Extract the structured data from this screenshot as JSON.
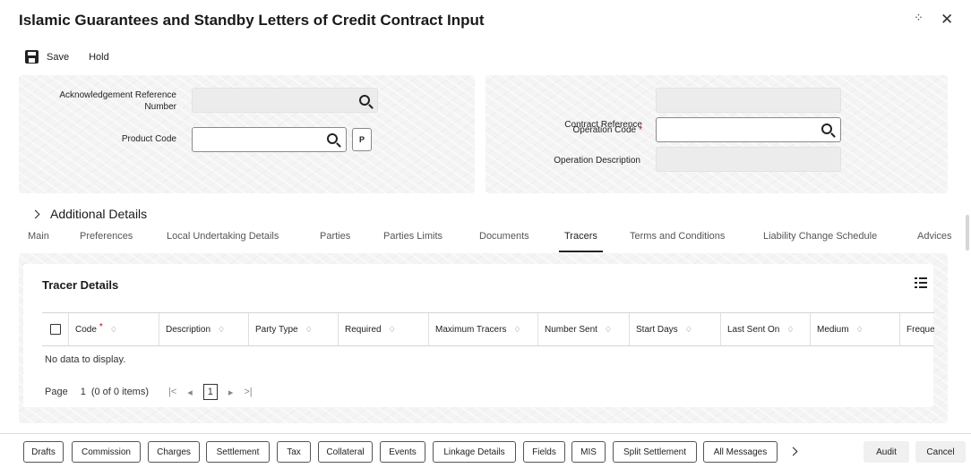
{
  "window": {
    "title": "Islamic Guarantees and Standby Letters of Credit Contract Input",
    "expand_glyph": "⁘",
    "close_glyph": "✕"
  },
  "toolbar": {
    "save_label": "Save",
    "hold_label": "Hold"
  },
  "header_left": {
    "ack_ref_label": "Acknowledgement Reference Number",
    "ack_ref_value": "",
    "product_code_label": "Product Code",
    "product_code_value": "",
    "p_button_label": "P"
  },
  "header_right": {
    "contract_ref_label": "Contract Reference",
    "contract_ref_value": "",
    "operation_code_label": "Operation Code",
    "operation_code_required": "*",
    "operation_code_value": "",
    "operation_desc_label": "Operation Description",
    "operation_desc_value": ""
  },
  "additional_details_label": "Additional Details",
  "tabs": [
    {
      "label": "Main",
      "active": false
    },
    {
      "label": "Preferences",
      "active": false
    },
    {
      "label": "Local Undertaking Details",
      "active": false
    },
    {
      "label": "Parties",
      "active": false
    },
    {
      "label": "Parties Limits",
      "active": false
    },
    {
      "label": "Documents",
      "active": false
    },
    {
      "label": "Tracers",
      "active": true
    },
    {
      "label": "Terms and Conditions",
      "active": false
    },
    {
      "label": "Liability Change Schedule",
      "active": false
    },
    {
      "label": "Advices",
      "active": false
    }
  ],
  "tracer": {
    "title": "Tracer Details",
    "columns": [
      {
        "label": "Code",
        "required": "*",
        "sort": "♢"
      },
      {
        "label": "Description",
        "sort": "♢"
      },
      {
        "label": "Party Type",
        "sort": "♢"
      },
      {
        "label": "Required",
        "sort": "♢"
      },
      {
        "label": "Maximum Tracers",
        "sort": "♢"
      },
      {
        "label": "Number Sent",
        "sort": "♢"
      },
      {
        "label": "Start Days",
        "sort": "♢"
      },
      {
        "label": "Last Sent On",
        "sort": "♢"
      },
      {
        "label": "Medium",
        "sort": "♢"
      },
      {
        "label": "Freque"
      }
    ],
    "empty_text": "No data to display.",
    "pager": {
      "page_label": "Page",
      "page_number": "1",
      "items_text": "(0 of 0 items)",
      "first": "|<",
      "prev": "◂",
      "current": "1",
      "next": "▸",
      "last": ">|"
    }
  },
  "footer": {
    "buttons": [
      "Drafts",
      "Commission",
      "Charges",
      "Settlement",
      "Tax",
      "Collateral",
      "Events",
      "Linkage Details",
      "Fields",
      "MIS",
      "Split Settlement",
      "All Messages"
    ],
    "audit_label": "Audit",
    "cancel_label": "Cancel"
  }
}
